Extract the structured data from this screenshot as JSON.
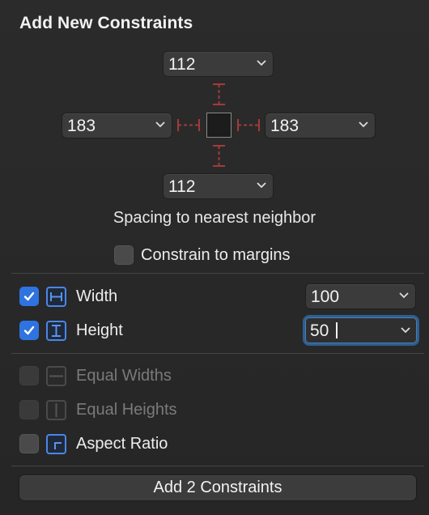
{
  "title": "Add New Constraints",
  "spacing": {
    "top": "112",
    "left": "183",
    "right": "183",
    "bottom": "112",
    "caption": "Spacing to nearest neighbor"
  },
  "constrain_margins": {
    "label": "Constrain to margins",
    "checked": false
  },
  "width": {
    "label": "Width",
    "value": "100",
    "checked": true
  },
  "height": {
    "label": "Height",
    "value": "50",
    "checked": true
  },
  "equal_widths": {
    "label": "Equal Widths",
    "enabled": false
  },
  "equal_heights": {
    "label": "Equal Heights",
    "enabled": false
  },
  "aspect_ratio": {
    "label": "Aspect Ratio",
    "checked": false
  },
  "add_button": "Add 2 Constraints",
  "colors": {
    "accent": "#2f73e0",
    "guide": "#a33a3a"
  }
}
